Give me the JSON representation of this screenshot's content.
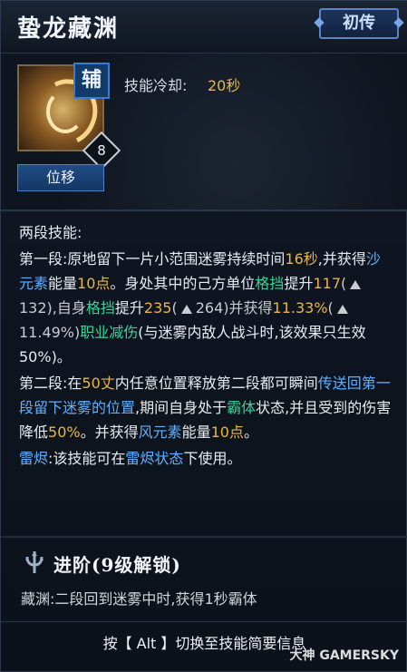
{
  "title": "蛰龙藏渊",
  "badge": "初传",
  "header": {
    "tag": "辅",
    "level": "8",
    "move_button": "位移",
    "cooldown_label": "技能冷却:",
    "cooldown_value": "20秒"
  },
  "body": {
    "intro": "两段技能:",
    "seg1_a": "第一段:原地留下一片小范围迷雾持续时间",
    "seg1_time": "16秒",
    "seg1_b": ",并获得",
    "seg1_elem": "沙元素",
    "seg1_c": "能量",
    "seg1_pts": "10点",
    "seg1_d": "。身处其中的己方单位",
    "seg1_gd": "格挡",
    "seg1_e": "提升",
    "seg1_v1": "117",
    "seg1_paren1_open": "(",
    "seg1_v1b": "132",
    "seg1_paren1_close": "),自身",
    "seg1_gd2": "格挡",
    "seg1_f": "提升",
    "seg1_v2": "235",
    "seg1_paren2_open": "(",
    "seg1_v2b": "264",
    "seg1_paren2_close": ")并获得",
    "seg1_pct": "11.33%",
    "seg1_paren3_open": "(",
    "seg1_pctb": "11.49%",
    "seg1_paren3_close": ")",
    "seg1_job": "职业减伤",
    "seg1_note": "(与迷雾内敌人战斗时,该效果只生效50%)。",
    "seg2_a": "第二段:在",
    "seg2_dist": "50丈",
    "seg2_b": "内任意位置释放第二段都可瞬间",
    "seg2_tp": "传送回第一段留下迷雾的位置",
    "seg2_c": ",期间自身处于",
    "seg2_ba": "霸体",
    "seg2_d": "状态,并且受到的伤害降低",
    "seg2_pct": "50%",
    "seg2_e": "。并获得",
    "seg2_elem": "风元素",
    "seg2_f": "能量",
    "seg2_pts": "10点",
    "seg2_g": "。",
    "lei_a": "雷烬",
    "lei_b": ":该技能可在",
    "lei_state": "雷烬状态",
    "lei_c": "下使用。"
  },
  "advanced": {
    "title": "进阶(9级解锁)",
    "text": "藏渊:二段回到迷雾中时,获得1秒霸体"
  },
  "footer": "按【 Alt 】切换至技能简要信息",
  "watermark": "大神 GAMERSKY"
}
